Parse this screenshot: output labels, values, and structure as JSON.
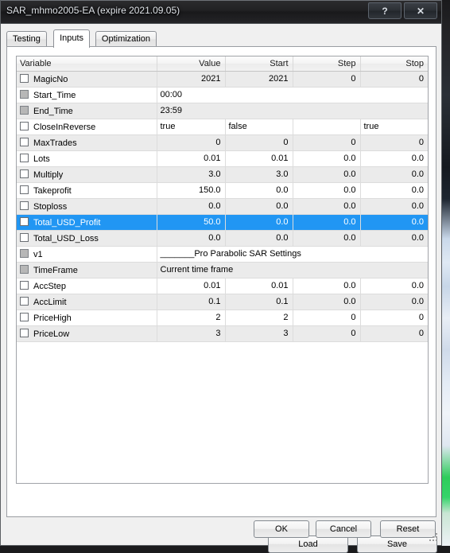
{
  "window": {
    "title": "SAR_mhmo2005-EA (expire 2021.09.05)",
    "help_label": "?",
    "close_label": "✕"
  },
  "tabs": [
    {
      "label": "Testing",
      "active": false
    },
    {
      "label": "Inputs",
      "active": true
    },
    {
      "label": "Optimization",
      "active": false
    }
  ],
  "grid": {
    "headers": [
      "Variable",
      "Value",
      "Start",
      "Step",
      "Stop"
    ],
    "rows": [
      {
        "variable": "MagicNo",
        "checkbox": "enabled",
        "kind": "num",
        "value": "2021",
        "start": "2021",
        "step": "0",
        "stop": "0"
      },
      {
        "variable": "Start_Time",
        "checkbox": "disabled",
        "kind": "text",
        "value": "00:00"
      },
      {
        "variable": "End_Time",
        "checkbox": "disabled",
        "kind": "text",
        "value": "23:59"
      },
      {
        "variable": "CloseInReverse",
        "checkbox": "enabled",
        "kind": "bool",
        "value": "true",
        "start": "false",
        "step": "",
        "stop": "true"
      },
      {
        "variable": "MaxTrades",
        "checkbox": "enabled",
        "kind": "num",
        "value": "0",
        "start": "0",
        "step": "0",
        "stop": "0"
      },
      {
        "variable": "Lots",
        "checkbox": "enabled",
        "kind": "num",
        "value": "0.01",
        "start": "0.01",
        "step": "0.0",
        "stop": "0.0"
      },
      {
        "variable": "Multiply",
        "checkbox": "enabled",
        "kind": "num",
        "value": "3.0",
        "start": "3.0",
        "step": "0.0",
        "stop": "0.0"
      },
      {
        "variable": "Takeprofit",
        "checkbox": "enabled",
        "kind": "num",
        "value": "150.0",
        "start": "0.0",
        "step": "0.0",
        "stop": "0.0"
      },
      {
        "variable": "Stoploss",
        "checkbox": "enabled",
        "kind": "num",
        "value": "0.0",
        "start": "0.0",
        "step": "0.0",
        "stop": "0.0"
      },
      {
        "variable": "Total_USD_Profit",
        "checkbox": "enabled",
        "kind": "num",
        "value": "50.0",
        "start": "0.0",
        "step": "0.0",
        "stop": "0.0",
        "selected": true
      },
      {
        "variable": "Total_USD_Loss",
        "checkbox": "enabled",
        "kind": "num",
        "value": "0.0",
        "start": "0.0",
        "step": "0.0",
        "stop": "0.0"
      },
      {
        "variable": "v1",
        "checkbox": "disabled",
        "kind": "text",
        "value": "_______Pro Parabolic SAR Settings"
      },
      {
        "variable": "TimeFrame",
        "checkbox": "disabled",
        "kind": "text",
        "value": "Current time frame"
      },
      {
        "variable": "AccStep",
        "checkbox": "enabled",
        "kind": "num",
        "value": "0.01",
        "start": "0.01",
        "step": "0.0",
        "stop": "0.0"
      },
      {
        "variable": "AccLimit",
        "checkbox": "enabled",
        "kind": "num",
        "value": "0.1",
        "start": "0.1",
        "step": "0.0",
        "stop": "0.0"
      },
      {
        "variable": "PriceHigh",
        "checkbox": "enabled",
        "kind": "num",
        "value": "2",
        "start": "2",
        "step": "0",
        "stop": "0"
      },
      {
        "variable": "PriceLow",
        "checkbox": "enabled",
        "kind": "num",
        "value": "3",
        "start": "3",
        "step": "0",
        "stop": "0"
      }
    ]
  },
  "file_buttons": {
    "load_label": "Load",
    "save_label": "Save"
  },
  "footer_buttons": {
    "ok_label": "OK",
    "cancel_label": "Cancel",
    "reset_label": "Reset"
  },
  "colors": {
    "selection": "#2196f3",
    "row_alt": "#ebebeb",
    "titlebar": "#212123"
  }
}
